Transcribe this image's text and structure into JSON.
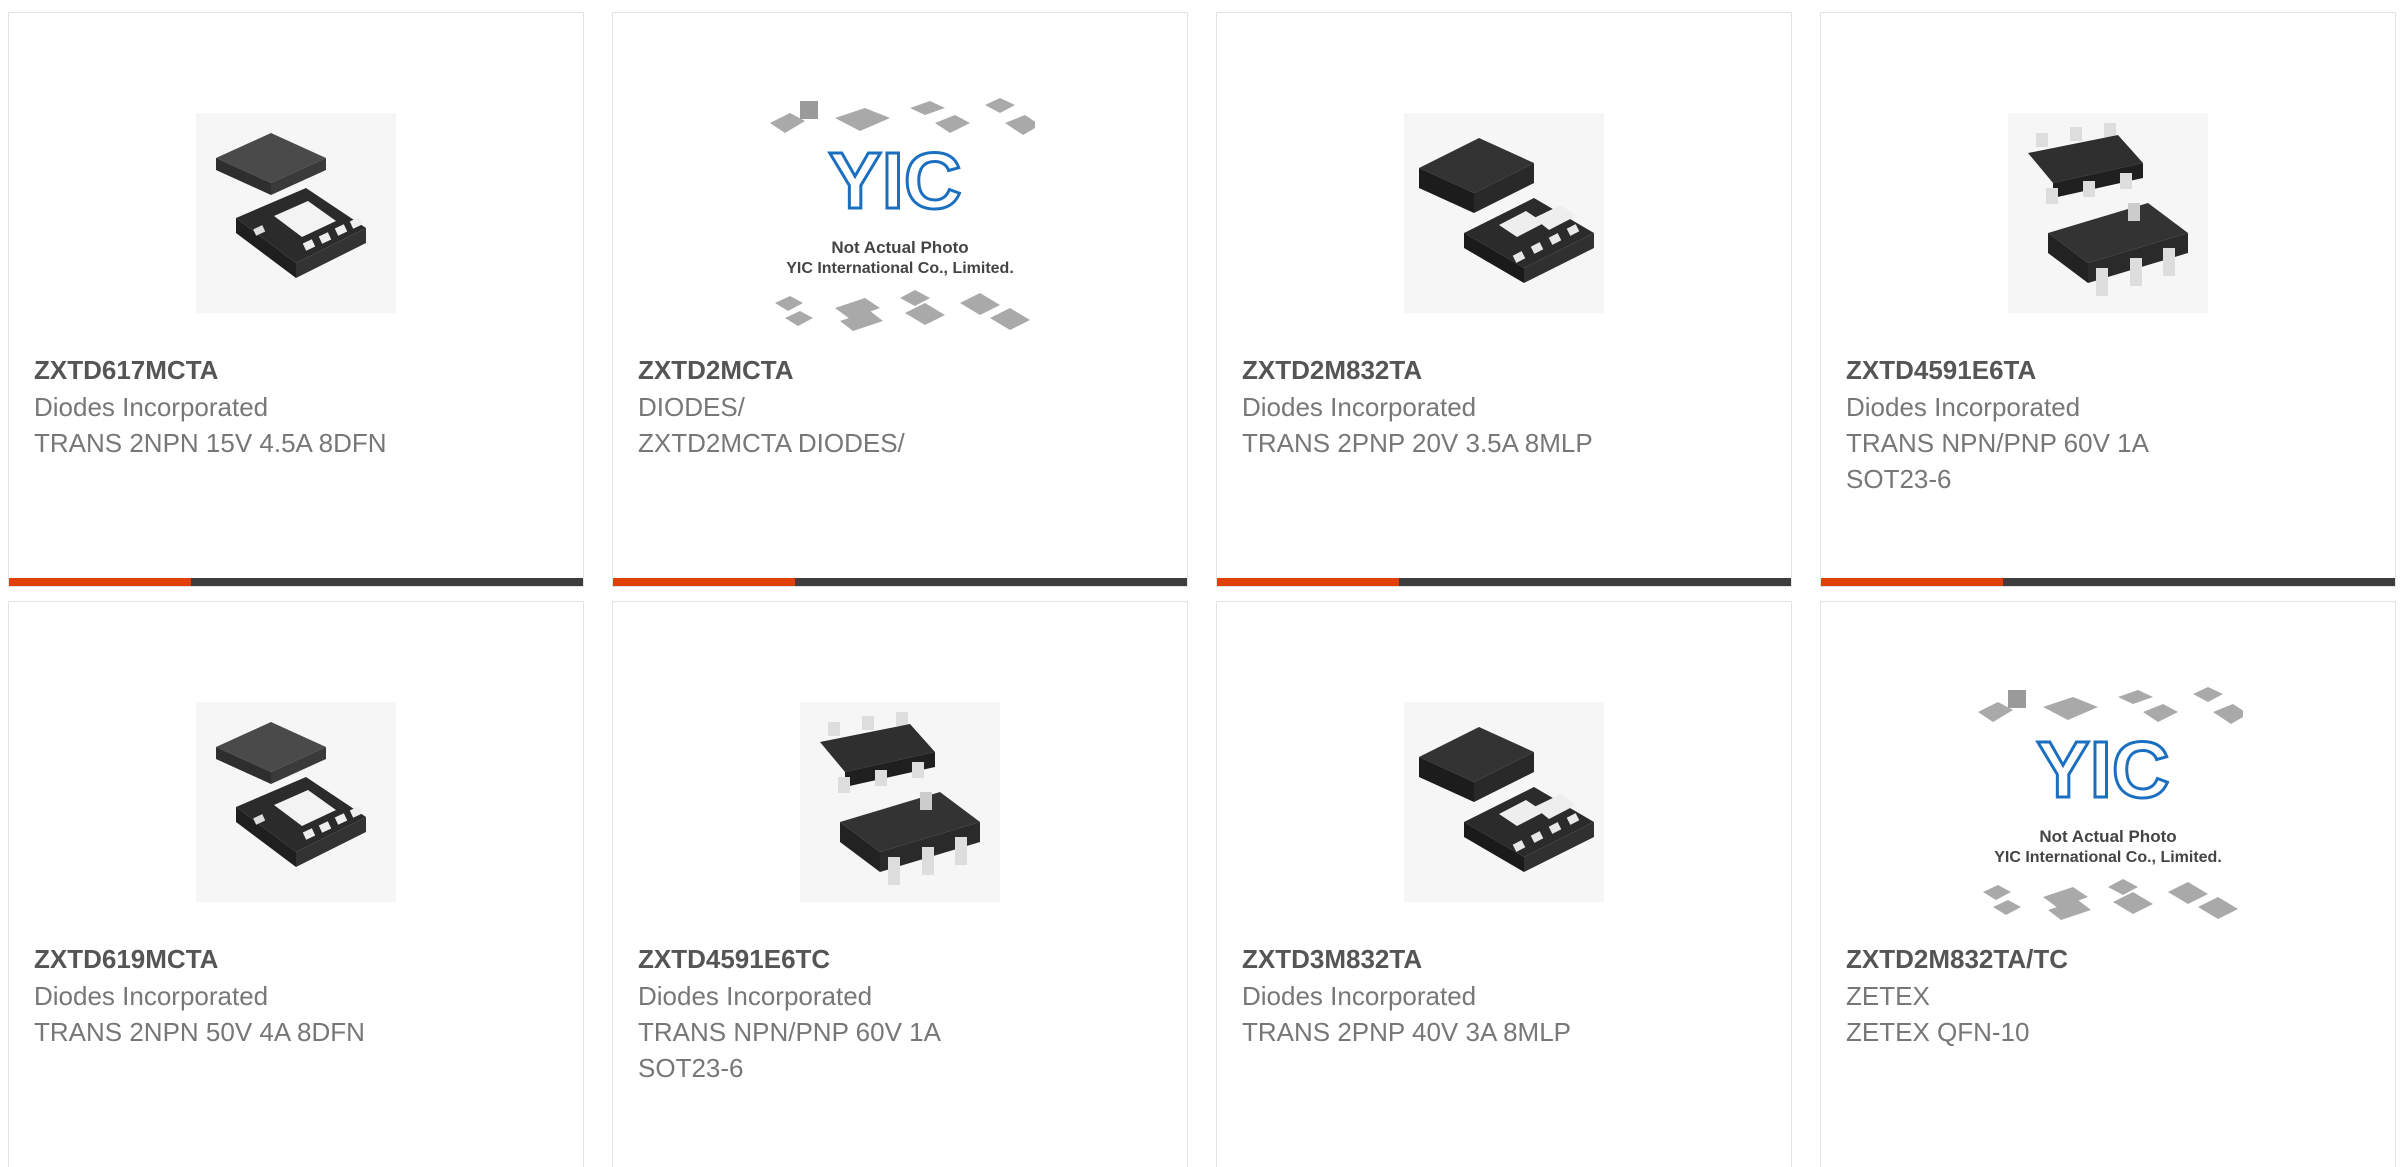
{
  "products": [
    {
      "part_number": "ZXTD617MCTA",
      "manufacturer": "Diodes Incorporated",
      "description": "TRANS 2NPN 15V 4.5A 8DFN",
      "image": "dfn8-package-photo"
    },
    {
      "part_number": "ZXTD2MCTA",
      "manufacturer": "DIODES/",
      "description": "ZXTD2MCTA DIODES/",
      "image": "yic-not-actual-photo",
      "placeholder": {
        "line1": "Not Actual Photo",
        "line2": "YIC International Co., Limited.",
        "logo": "YIC"
      }
    },
    {
      "part_number": "ZXTD2M832TA",
      "manufacturer": "Diodes Incorporated",
      "description": "TRANS 2PNP 20V 3.5A 8MLP",
      "image": "mlp8-package-photo"
    },
    {
      "part_number": "ZXTD4591E6TA",
      "manufacturer": "Diodes Incorporated",
      "description": "TRANS NPN/PNP 60V 1A SOT23-6",
      "image": "sot23-6-package-photo"
    },
    {
      "part_number": "ZXTD619MCTA",
      "manufacturer": "Diodes Incorporated",
      "description": "TRANS 2NPN 50V 4A 8DFN",
      "image": "dfn8-package-photo"
    },
    {
      "part_number": "ZXTD4591E6TC",
      "manufacturer": "Diodes Incorporated",
      "description": "TRANS NPN/PNP 60V 1A SOT23-6",
      "image": "sot23-6-package-photo"
    },
    {
      "part_number": "ZXTD3M832TA",
      "manufacturer": "Diodes Incorporated",
      "description": "TRANS 2PNP 40V 3A 8MLP",
      "image": "mlp8-package-photo"
    },
    {
      "part_number": "ZXTD2M832TA/TC",
      "manufacturer": "ZETEX",
      "description": "ZETEX QFN-10",
      "image": "yic-not-actual-photo",
      "placeholder": {
        "line1": "Not Actual Photo",
        "line2": "YIC International Co., Limited.",
        "logo": "YIC"
      }
    }
  ],
  "colors": {
    "accent": "#e04006",
    "bar": "#3d3d3d",
    "part_number": "#555555",
    "text": "#777777",
    "yic_blue": "#1a6fc0"
  }
}
